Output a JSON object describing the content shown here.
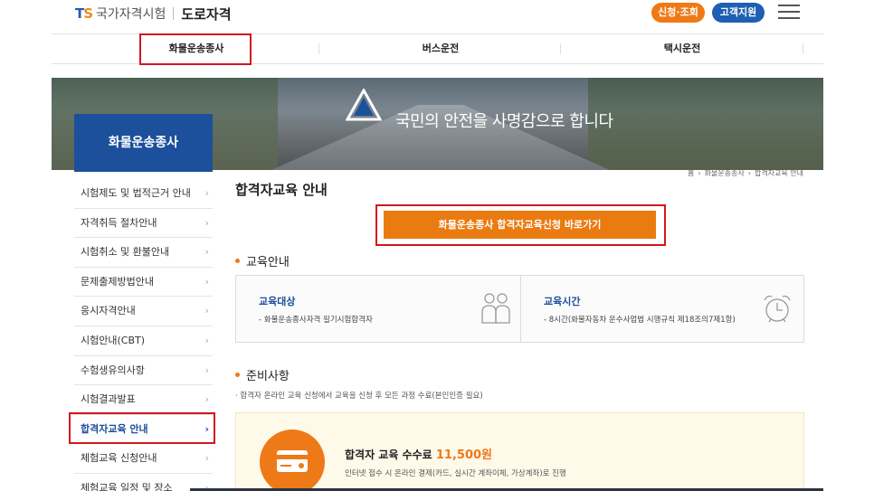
{
  "header": {
    "logo_mark_t": "T",
    "logo_mark_s": "S",
    "logo_org": "국가자격시험",
    "logo_sub": "도로자격",
    "btn_inquiry": "신청·조회",
    "btn_support": "고객지원"
  },
  "topnav": {
    "items": [
      "화물운송종사",
      "버스운전",
      "택시운전"
    ]
  },
  "banner": {
    "text": "국민의 안전을 사명감으로 합니다"
  },
  "sidebar": {
    "title": "화물운송종사",
    "items": [
      "시험제도 및 법적근거 안내",
      "자격취득 절차안내",
      "시험취소 및 환불안내",
      "문제출제방법안내",
      "응시자격안내",
      "시험안내(CBT)",
      "수험생유의사항",
      "시험결과발표",
      "합격자교육 안내",
      "체험교육 신청안내",
      "체험교육 일정 및 장소"
    ],
    "chevron": "›"
  },
  "breadcrumb": [
    "홈",
    "›",
    "화물운송종사",
    "›",
    "합격자교육 안내"
  ],
  "main": {
    "title": "합격자교육 안내",
    "cta": "화물운송종사 합격자교육신청 바로가기",
    "section1": "교육안내",
    "target_label": "교육대상",
    "target_desc": "- 화물운송종사자격 필기시험합격자",
    "time_label": "교육시간",
    "time_desc": "- 8시간(화물자동차 운수사업법 시행규칙 제18조의7제1항)",
    "section2": "준비사항",
    "prep_note": "· 합격자 온라인 교육 신청에서 교육을 신청 후 모든 과정 수료(본인인증 필요)",
    "fee_title": "합격자 교육 수수료",
    "fee_amount": "11,500원",
    "fee_desc": "인터넷 접수 시 온라인 결제(카드, 실시간 계좌이체, 가상계좌)로 진행"
  },
  "colors": {
    "accent_orange": "#ee7a17",
    "brand_blue": "#1c4f9c",
    "highlight_red": "#d4161c"
  }
}
